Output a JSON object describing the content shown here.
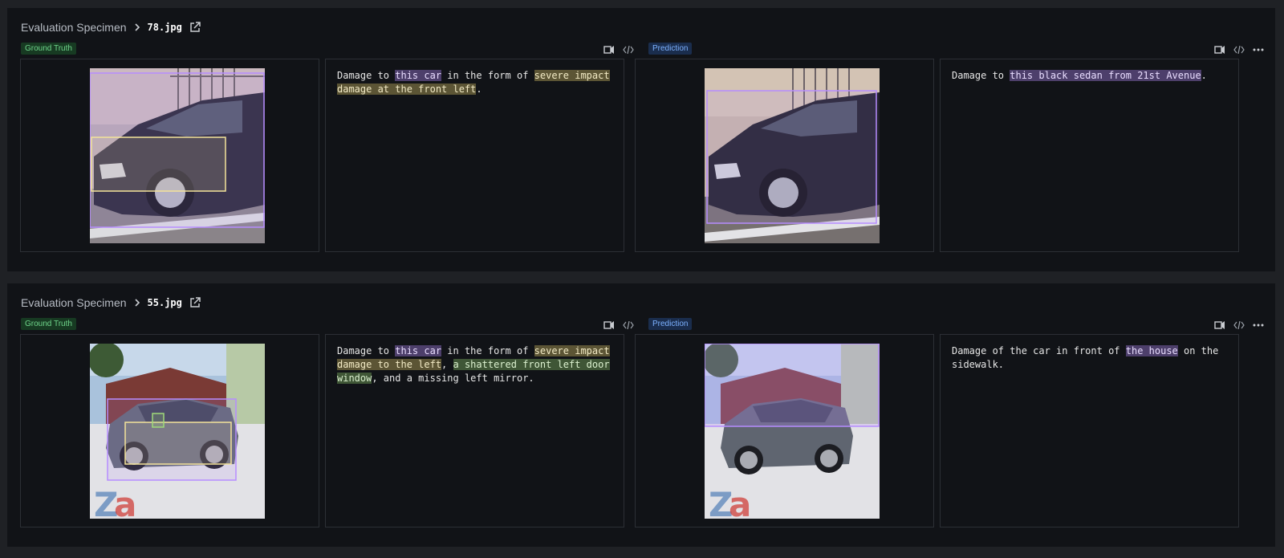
{
  "specimens": [
    {
      "breadcrumb_root": "Evaluation Specimen",
      "filename": "78.jpg",
      "ground_truth_label": "Ground Truth",
      "prediction_label": "Prediction",
      "gt_text": {
        "p1": "Damage to ",
        "h1": "this car",
        "p2": " in the form of ",
        "h2": "severe impact damage at the front left",
        "p3": "."
      },
      "pred_text": {
        "p1": "Damage to ",
        "h1": "this black sedan from 21st Avenue",
        "p2": "."
      }
    },
    {
      "breadcrumb_root": "Evaluation Specimen",
      "filename": "55.jpg",
      "ground_truth_label": "Ground Truth",
      "prediction_label": "Prediction",
      "gt_text": {
        "p1": "Damage to ",
        "h1": "this car",
        "p2": " in the form of ",
        "h2": "severe impact damage to the left",
        "p3": ", ",
        "h3": "a shattered front left door window",
        "p4": ", and a missing left mirror."
      },
      "pred_text": {
        "p1": "Damage of the car in front of ",
        "h1": "the house",
        "p2": " on the sidewalk."
      }
    }
  ],
  "icons": {
    "breadcrumb_separator": "chevron-right-icon",
    "open_external": "external-link-icon",
    "toolbar": [
      "speaker-icon",
      "code-icon",
      "more-icon"
    ]
  },
  "colors": {
    "card_bg": "#111317",
    "page_bg": "#1f2125",
    "highlight_purple": "#4d3f6b",
    "highlight_yellow": "#5c5535",
    "highlight_green": "#3f5636",
    "box_purple": "#b68cff",
    "box_yellow": "#f3e39a",
    "box_green": "#9fd97a"
  }
}
